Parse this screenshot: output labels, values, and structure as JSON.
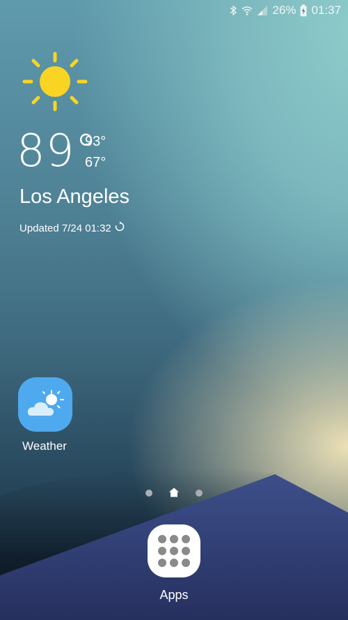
{
  "status_bar": {
    "battery_percent": "26%",
    "time": "01:37",
    "icons": [
      "bluetooth-icon",
      "wifi-icon",
      "signal-icon",
      "battery-charging-icon"
    ]
  },
  "weather_widget": {
    "condition_icon": "sun-icon",
    "temperature": "89°",
    "high": "93°",
    "low": "67°",
    "city": "Los Angeles",
    "updated": "Updated 7/24 01:32",
    "refresh_icon": "refresh-icon",
    "sun_color": "#f9d423"
  },
  "home_apps": [
    {
      "label": "Weather",
      "icon": "partly-cloudy-icon",
      "color": "#4fa9ee"
    }
  ],
  "page_indicator": {
    "pages": 3,
    "current": 2,
    "home_page": 2
  },
  "dock": {
    "apps_label": "Apps",
    "icon": "app-grid-icon"
  }
}
